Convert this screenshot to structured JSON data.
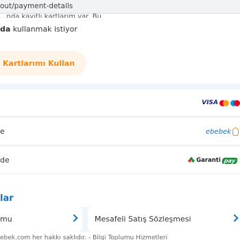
{
  "browser": {
    "url": "out/payment-details"
  },
  "consent": {
    "cut_line": "...nda kayıtlı kartlarım var. Bu",
    "bold_part": "da",
    "rest": " kullanmak istiyor"
  },
  "use_cards_button": {
    "label": "Kartlarımı Kullan"
  },
  "payment_methods": [
    {
      "label": "",
      "logo": "visa-mastercard-maestro"
    },
    {
      "label": "e",
      "logo": "ebebek",
      "logo_text": "ebebek"
    },
    {
      "label": "de",
      "logo": "garanti-pay",
      "logo_text": "Garanti",
      "logo_badge": "pay"
    }
  ],
  "contracts": {
    "title": "lar",
    "items": [
      {
        "label": "mu"
      },
      {
        "label": "Mesafeli Satış Sözleşmesi"
      }
    ]
  },
  "footer": {
    "text": "ebek.com her hakkı saklıdır. - Bilgi Toplumu Hizmetleri"
  },
  "colors": {
    "brand_orange": "#f08a1c",
    "brand_blue": "#1b6fb5",
    "visa_blue": "#1a1f71",
    "mc_red": "#eb001b",
    "mc_yellow": "#f79e1b",
    "maestro_blue": "#0099df",
    "garanti_green": "#1e8a3e",
    "panel_bg": "#eef5fb"
  }
}
